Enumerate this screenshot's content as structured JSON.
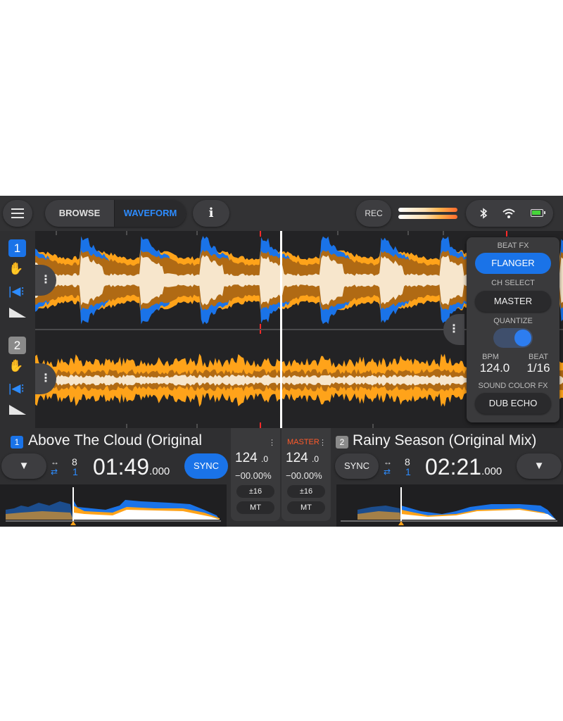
{
  "topbar": {
    "browse_label": "BROWSE",
    "waveform_label": "WAVEFORM",
    "info_label": "i",
    "rec_label": "REC",
    "icons": [
      "menu-icon",
      "bluetooth-icon",
      "wifi-icon",
      "battery-icon"
    ]
  },
  "decks": [
    {
      "number": "1",
      "title": "Above The Cloud (Original",
      "loop_beats": "8",
      "loop_sub": "1",
      "time_main": "01:49",
      "time_ms": ".000",
      "sync_label": "SYNC",
      "load_icon": "▼",
      "bpm": "124",
      "bpm_dec": ".0",
      "pitch": "−00.00%",
      "range_label": "±16",
      "mt_label": "MT",
      "color": "#1a73e8"
    },
    {
      "number": "2",
      "title": "Rainy Season (Original Mix)",
      "loop_beats": "8",
      "loop_sub": "1",
      "time_main": "02:21",
      "time_ms": ".000",
      "sync_label": "SYNC",
      "load_icon": "▼",
      "bpm": "124",
      "bpm_dec": ".0",
      "pitch": "−00.00%",
      "range_label": "±16",
      "mt_label": "MT",
      "master_label": "MASTER",
      "color": "#8a8a8a"
    }
  ],
  "fx": {
    "beat_fx_label": "BEAT FX",
    "beat_fx_value": "FLANGER",
    "ch_select_label": "CH SELECT",
    "ch_select_value": "MASTER",
    "quantize_label": "QUANTIZE",
    "quantize_on": true,
    "bpm_label": "BPM",
    "bpm_value": "124.0",
    "beat_label": "BEAT",
    "beat_value": "1/16",
    "sound_color_label": "SOUND COLOR FX",
    "sound_color_value": "DUB ECHO"
  },
  "colors": {
    "accent_blue": "#1a73e8",
    "wave_orange": "#ffa31a",
    "wave_brown": "#b06a14",
    "wave_cream": "#f7e6cc",
    "master_red": "#ff5a2a"
  }
}
